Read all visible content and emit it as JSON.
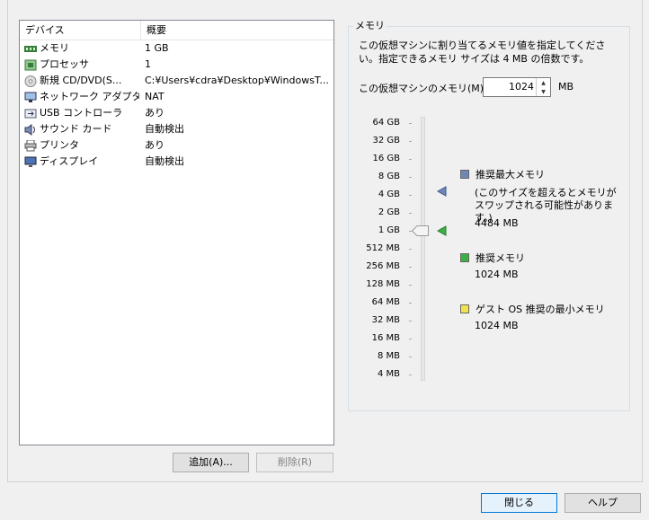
{
  "device_list": {
    "headers": {
      "device": "デバイス",
      "summary": "概要"
    },
    "rows": [
      {
        "icon": "memory-icon",
        "name": "メモリ",
        "value": "1 GB"
      },
      {
        "icon": "processor-icon",
        "name": "プロセッサ",
        "value": "1"
      },
      {
        "icon": "cd-dvd-icon",
        "name": "新規 CD/DVD(S...",
        "value": "C:¥Users¥cdra¥Desktop¥WindowsT..."
      },
      {
        "icon": "network-adapter-icon",
        "name": "ネットワーク アダプタ",
        "value": "NAT"
      },
      {
        "icon": "usb-icon",
        "name": "USB コントローラ",
        "value": "あり"
      },
      {
        "icon": "sound-icon",
        "name": "サウンド カード",
        "value": "自動検出"
      },
      {
        "icon": "printer-icon",
        "name": "プリンタ",
        "value": "あり"
      },
      {
        "icon": "display-icon",
        "name": "ディスプレイ",
        "value": "自動検出"
      }
    ]
  },
  "buttons": {
    "add": "追加(A)...",
    "remove": "削除(R)",
    "close": "閉じる",
    "help": "ヘルプ"
  },
  "memory": {
    "group_title": "メモリ",
    "description": "この仮想マシンに割り当てるメモリ値を指定してください。指定できるメモリ サイズは 4 MB の倍数です。",
    "field_label": "この仮想マシンのメモリ(M):",
    "value": "1024",
    "unit": "MB",
    "scale": [
      "64 GB",
      "32 GB",
      "16 GB",
      "8 GB",
      "4 GB",
      "2 GB",
      "1 GB",
      "512 MB",
      "256 MB",
      "128 MB",
      "64 MB",
      "32 MB",
      "16 MB",
      "8 MB",
      "4 MB"
    ],
    "recommended_max": {
      "label": "推奨最大メモリ",
      "note": "(このサイズを超えるとメモリがスワップされる可能性があります。)",
      "value": "4484 MB",
      "color": "#6f87b7"
    },
    "recommended": {
      "label": "推奨メモリ",
      "value": "1024 MB",
      "color": "#3cb043"
    },
    "guest_min": {
      "label": "ゲスト OS 推奨の最小メモリ",
      "value": "1024 MB",
      "color": "#f2e34c"
    }
  }
}
